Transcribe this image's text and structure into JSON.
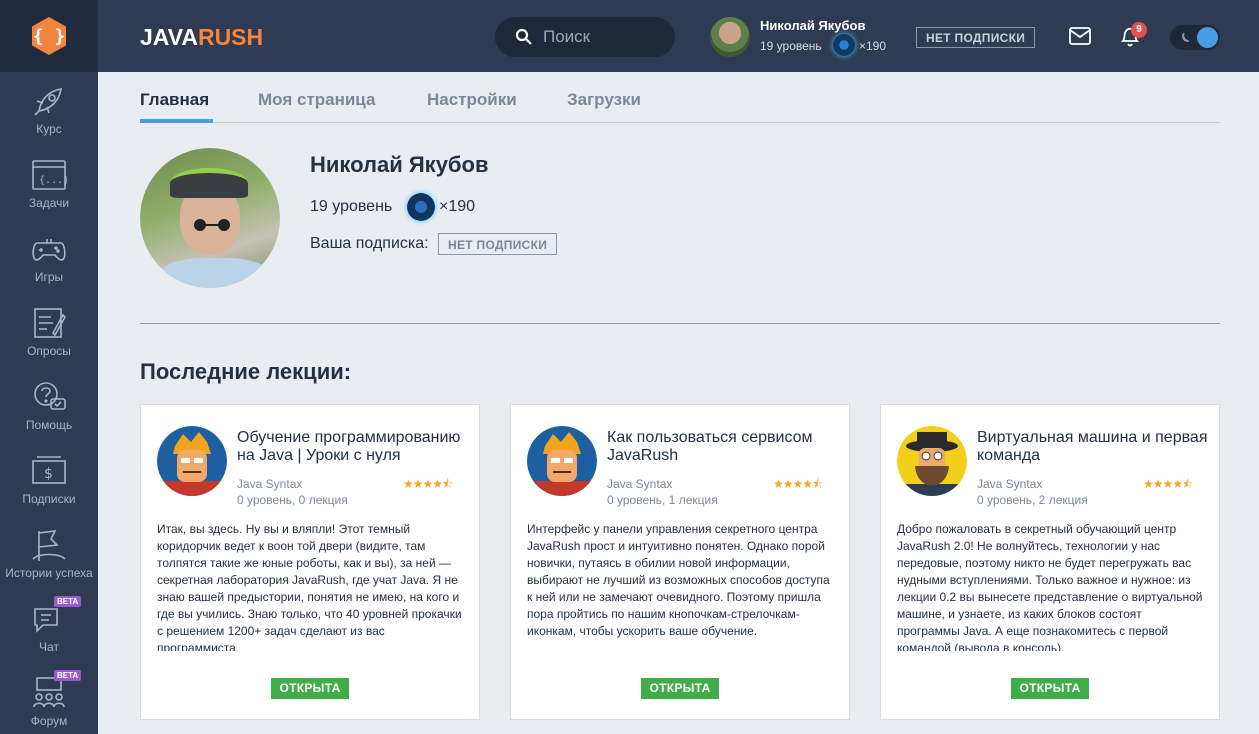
{
  "brand": {
    "part1": "JAVA",
    "part2": "RUSH"
  },
  "sidebar": {
    "items": [
      {
        "label": "Курс"
      },
      {
        "label": "Задачи"
      },
      {
        "label": "Игры"
      },
      {
        "label": "Опросы"
      },
      {
        "label": "Помощь"
      },
      {
        "label": "Подписки"
      },
      {
        "label": "Истории успеха"
      },
      {
        "label": "Чат",
        "badge": "BETA"
      },
      {
        "label": "Форум",
        "badge": "BETA"
      }
    ]
  },
  "header": {
    "search_placeholder": "Поиск",
    "user_name": "Николай Якубов",
    "user_level": "19 уровень",
    "gems": "×190",
    "subscription": "НЕТ ПОДПИСКИ",
    "notifications": "9"
  },
  "tabs": [
    {
      "label": "Главная",
      "active": true
    },
    {
      "label": "Моя страница"
    },
    {
      "label": "Настройки"
    },
    {
      "label": "Загрузки"
    }
  ],
  "profile": {
    "name": "Николай Якубов",
    "level": "19 уровень",
    "gems": "×190",
    "subscription_label": "Ваша подписка:",
    "subscription": "НЕТ ПОДПИСКИ"
  },
  "section_title": "Последние лекции:",
  "lectures": [
    {
      "title": "Обучение программированию на Java | Уроки с нуля",
      "course": "Java Syntax",
      "progress": "0 уровень, 0 лекция",
      "rating": 4.5,
      "text": "Итак, вы здесь. Ну вы и вляпли! Этот темный коридорчик ведет к воон той двери (видите, там толпятся такие же юные роботы, как и вы), за ней — секретная лаборатория JavaRush, где учат Java. Я не знаю вашей предыстории, понятия не имею, на кого и где вы учились. Знаю только, что 40 уровней прокачки с решением 1200+ задач сделают из вас программиста.",
      "button": "ОТКРЫТА"
    },
    {
      "title": "Как пользоваться сервисом JavaRush",
      "course": "Java Syntax",
      "progress": "0 уровень, 1 лекция",
      "rating": 4.5,
      "text": "Интерфейс у панели управления секретного центра JavaRush прост и интуитивно понятен. Однако порой новички, путаясь в обилии новой информации, выбирают не лучший из возможных способов доступа к ней или не замечают очевидного. Поэтому пришла пора пройтись по нашим кнопочкам-стрелочкам-иконкам, чтобы ускорить ваше обучение.",
      "button": "ОТКРЫТА"
    },
    {
      "title": "Виртуальная машина и первая команда",
      "course": "Java Syntax",
      "progress": "0 уровень, 2 лекция",
      "rating": 4.5,
      "text": "Добро пожаловать в секретный обучающий центр JavaRush 2.0! Не волнуйтесь, технологии у нас передовые, поэтому никто не будет перегружать вас нудными вступлениями. Только важное и нужное: из лекции 0.2 вы вынесете представление о виртуальной машине, и узнаете, из каких блоков состоят программы Java. А еще познакомитесь с первой командой (вывода в консоль).",
      "button": "ОТКРЫТА"
    }
  ],
  "colors": {
    "sidebar": "#2e3b52",
    "accent": "#4a9de0",
    "brand_orange": "#f5843e",
    "button_green": "#3fae49"
  }
}
